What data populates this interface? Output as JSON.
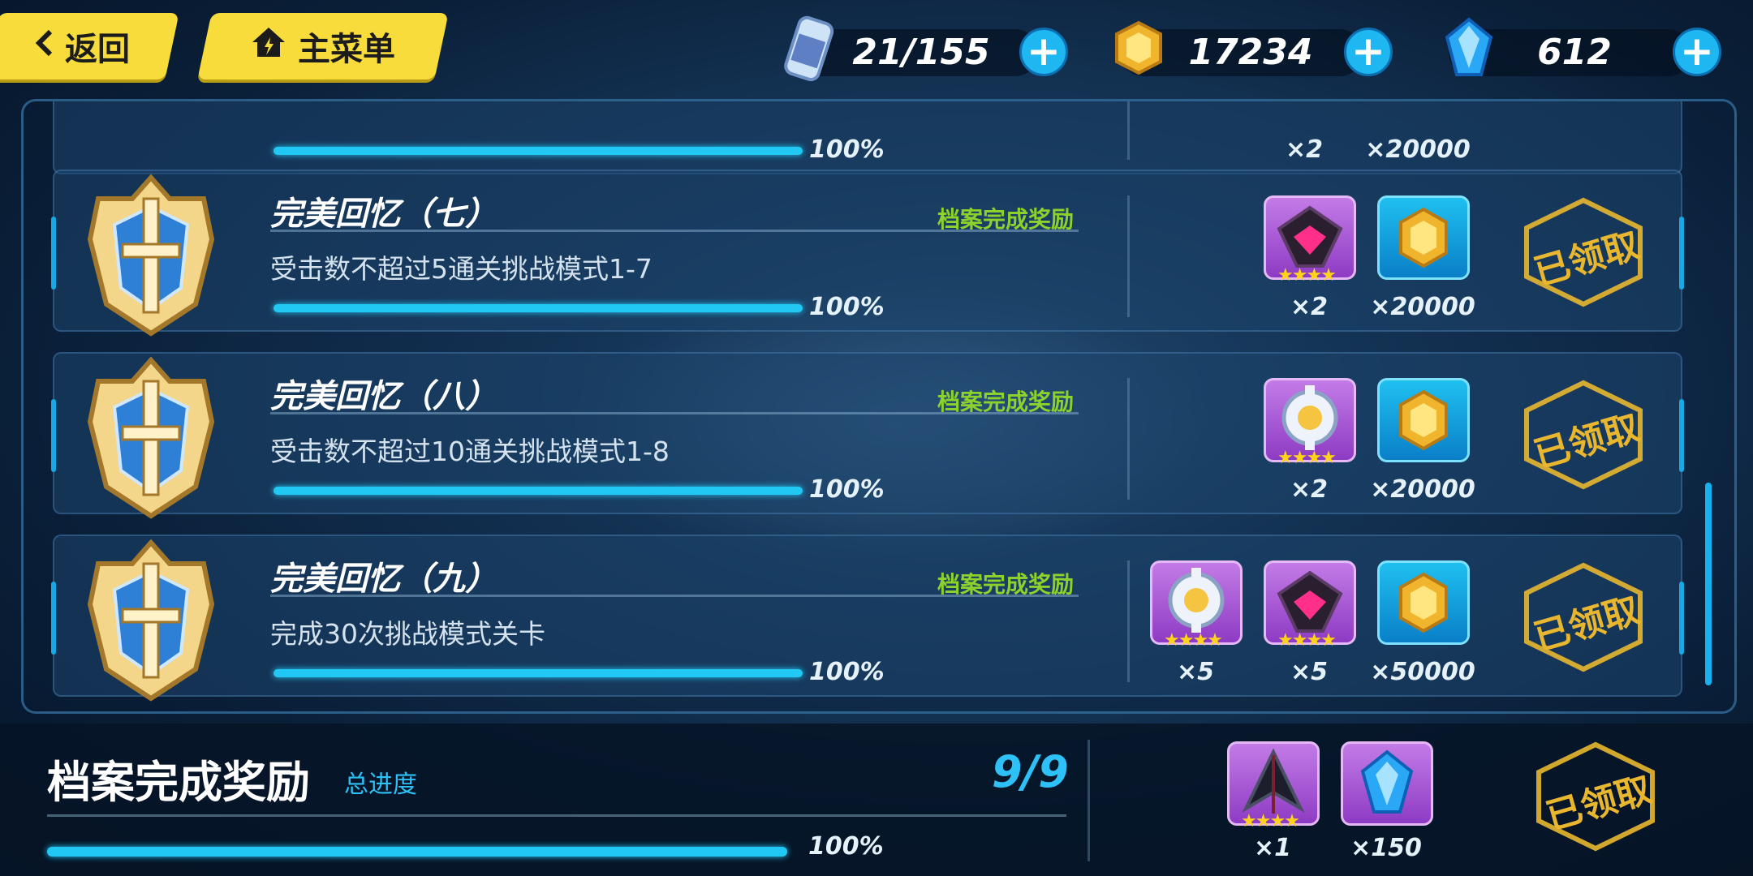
{
  "nav": {
    "back_label": "返回",
    "menu_label": "主菜单"
  },
  "resources": {
    "stamina": "21/155",
    "coins": "17234",
    "crystals": "612"
  },
  "rows": [
    {
      "title": "",
      "tag": "",
      "desc": "",
      "progress_pct": 100,
      "progress_label": "100%",
      "rewards": [
        {
          "icon": "item-icon",
          "qty": "×2"
        },
        {
          "icon": "coin-icon",
          "qty": "×20000"
        }
      ]
    },
    {
      "title": "完美回忆（七）",
      "tag": "档案完成奖励",
      "desc": "受击数不超过5通关挑战模式1-7",
      "progress_pct": 100,
      "progress_label": "100%",
      "rewards": [
        {
          "icon": "stigmata-triangle-icon",
          "qty": "×2",
          "stars": "★★★★"
        },
        {
          "icon": "coin-icon",
          "qty": "×20000"
        }
      ],
      "status": "已领取"
    },
    {
      "title": "完美回忆（八）",
      "tag": "档案完成奖励",
      "desc": "受击数不超过10通关挑战模式1-8",
      "progress_pct": 100,
      "progress_label": "100%",
      "rewards": [
        {
          "icon": "material-gear-icon",
          "qty": "×2",
          "stars": "★★★★"
        },
        {
          "icon": "coin-icon",
          "qty": "×20000"
        }
      ],
      "status": "已领取"
    },
    {
      "title": "完美回忆（九）",
      "tag": "档案完成奖励",
      "desc": "完成30次挑战模式关卡",
      "progress_pct": 100,
      "progress_label": "100%",
      "rewards": [
        {
          "icon": "material-gear-icon",
          "qty": "×5",
          "stars": "★★★★"
        },
        {
          "icon": "stigmata-triangle-icon",
          "qty": "×5",
          "stars": "★★★★"
        },
        {
          "icon": "coin-icon",
          "qty": "×50000"
        }
      ],
      "status": "已领取"
    }
  ],
  "summary": {
    "title": "档案完成奖励",
    "subtitle": "总进度",
    "count": "9/9",
    "progress_pct": 100,
    "progress_label": "100%",
    "rewards": [
      {
        "icon": "weapon-icon",
        "qty": "×1",
        "stars": "★★★★"
      },
      {
        "icon": "crystal-icon",
        "qty": "×150"
      }
    ],
    "status": "已领取"
  },
  "colors": {
    "accent": "#22c8f4",
    "tag_green": "#8dd22c",
    "stamp_gold": "#e8b72f",
    "button_yellow": "#f7dc3c"
  }
}
